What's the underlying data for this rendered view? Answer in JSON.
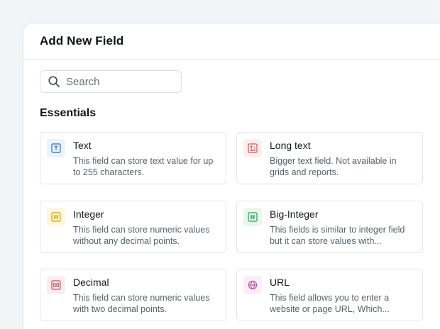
{
  "dialog": {
    "title": "Add New Field"
  },
  "search": {
    "placeholder": "Search",
    "value": ""
  },
  "section": {
    "title": "Essentials"
  },
  "fields": [
    {
      "name": "Text",
      "description": "This field can store text value for up to 255 characters.",
      "icon": "text-field-icon",
      "icon_color": "#2d6db5",
      "icon_bg": "#eaf2fb"
    },
    {
      "name": "Long text",
      "description": "Bigger text field. Not available in grids and reports.",
      "icon": "long-text-field-icon",
      "icon_color": "#d45454",
      "icon_bg": "#fdeeee"
    },
    {
      "name": "Integer",
      "description": "This field can store numeric values without any decimal points.",
      "icon": "integer-field-icon",
      "icon_color": "#c9a400",
      "icon_bg": "#fdf8dc"
    },
    {
      "name": "Big-Integer",
      "description": "This fields is similar to integer field but it can store values with...",
      "icon": "big-integer-field-icon",
      "icon_color": "#2f9e55",
      "icon_bg": "#e8f6ec"
    },
    {
      "name": "Decimal",
      "description": "This field can store numeric values with two decimal points.",
      "icon": "decimal-field-icon",
      "icon_color": "#c84a5a",
      "icon_bg": "#fcecef"
    },
    {
      "name": "URL",
      "description": "This field allows you to enter a website or page URL, Which...",
      "icon": "url-field-icon",
      "icon_color": "#b8489a",
      "icon_bg": "#fbeef7"
    }
  ]
}
